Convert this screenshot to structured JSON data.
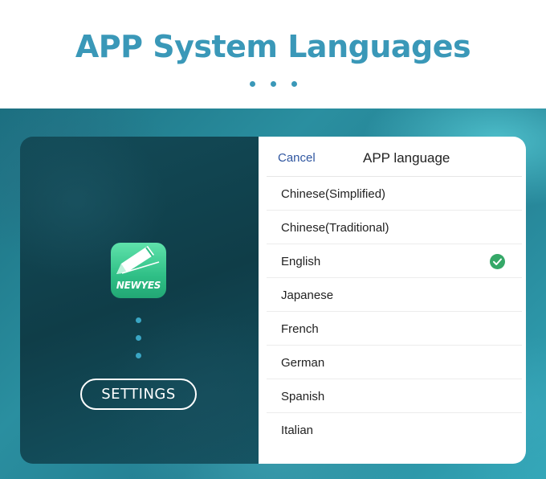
{
  "header": {
    "title": "APP System Languages"
  },
  "app": {
    "icon_name": "newyes-pen-icon",
    "icon_text": "NEWYES",
    "settings_label": "SETTINGS"
  },
  "language_picker": {
    "cancel_label": "Cancel",
    "title": "APP language",
    "selected": "English",
    "items": [
      {
        "label": "Chinese(Simplified)",
        "selected": false
      },
      {
        "label": "Chinese(Traditional)",
        "selected": false
      },
      {
        "label": "English",
        "selected": true
      },
      {
        "label": "Japanese",
        "selected": false
      },
      {
        "label": "French",
        "selected": false
      },
      {
        "label": "German",
        "selected": false
      },
      {
        "label": "Spanish",
        "selected": false
      },
      {
        "label": "Italian",
        "selected": false
      }
    ]
  },
  "colors": {
    "accent": "#3a98b8",
    "check": "#35a868",
    "cancel": "#2f56a0",
    "icon_green": "#2fbf86"
  }
}
